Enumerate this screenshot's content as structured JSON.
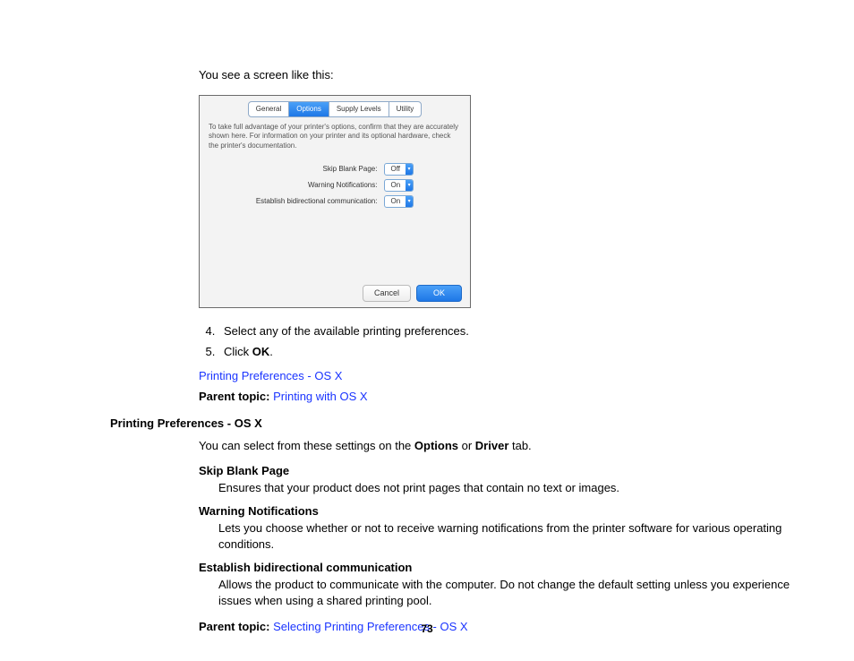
{
  "intro_line": "You see a screen like this:",
  "dialog": {
    "tabs": [
      "General",
      "Options",
      "Supply Levels",
      "Utility"
    ],
    "active_tab_index": 1,
    "note": "To take full advantage of your printer's options, confirm that they are accurately shown here. For information on your printer and its optional hardware, check the printer's documentation.",
    "options": [
      {
        "label": "Skip Blank Page:",
        "value": "Off"
      },
      {
        "label": "Warning Notifications:",
        "value": "On"
      },
      {
        "label": "Establish bidirectional communication:",
        "value": "On"
      }
    ],
    "cancel": "Cancel",
    "ok": "OK"
  },
  "steps": {
    "s4": "Select any of the available printing preferences.",
    "s5_prefix": "Click ",
    "s5_bold": "OK",
    "s5_suffix": "."
  },
  "link1": "Printing Preferences - OS X",
  "parent_label": "Parent topic: ",
  "parent_link1": "Printing with OS X",
  "heading": "Printing Preferences - OS X",
  "para_parts": {
    "a": "You can select from these settings on the ",
    "b": "Options",
    "c": " or ",
    "d": "Driver",
    "e": " tab."
  },
  "defs": {
    "t1": "Skip Blank Page",
    "d1": "Ensures that your product does not print pages that contain no text or images.",
    "t2": "Warning Notifications",
    "d2": "Lets you choose whether or not to receive warning notifications from the printer software for various operating conditions.",
    "t3": "Establish bidirectional communication",
    "d3": "Allows the product to communicate with the computer. Do not change the default setting unless you experience issues when using a shared printing pool."
  },
  "parent_link2": "Selecting Printing Preferences - OS X",
  "page_number": "73"
}
